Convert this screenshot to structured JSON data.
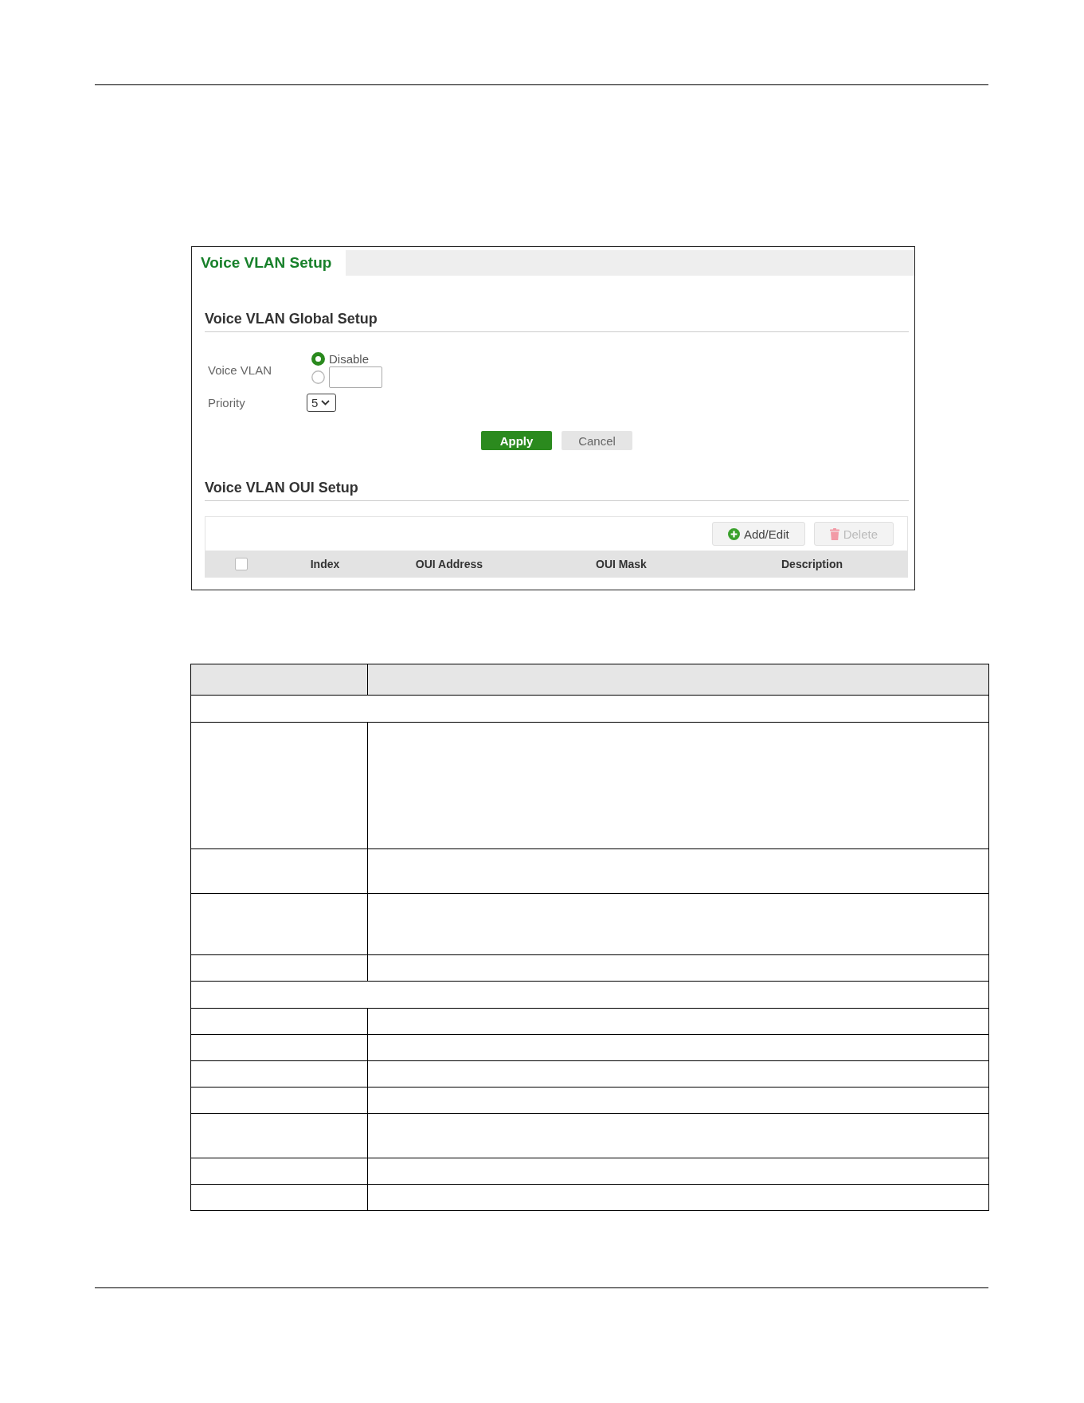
{
  "tabs": [
    {
      "label": "Voice VLAN Setup",
      "selected": true
    }
  ],
  "global_setup": {
    "title": "Voice VLAN Global Setup",
    "fields": [
      {
        "kind": "radio_group",
        "label": "Voice VLAN",
        "options": [
          {
            "kind": "labeled",
            "label": "Disable",
            "selected": true
          },
          {
            "kind": "input",
            "selected": false
          }
        ]
      },
      {
        "kind": "select",
        "label": "Priority",
        "value": "5"
      }
    ],
    "buttons": [
      {
        "kind": "primary",
        "label": "Apply"
      },
      {
        "kind": "secondary",
        "label": "Cancel"
      }
    ]
  },
  "oui_setup": {
    "title": "Voice VLAN OUI Setup",
    "buttons": [
      {
        "kind": "add",
        "label": "Add/Edit",
        "disabled": false
      },
      {
        "kind": "delete",
        "label": "Delete",
        "disabled": true
      }
    ],
    "table": {
      "header_checkbox": {
        "checked": false
      },
      "columns": [
        "Index",
        "OUI Address",
        "OUI Mask",
        "Description"
      ]
    }
  },
  "description_table": {
    "rows": [
      {
        "kind": "header"
      },
      {
        "kind": "section"
      },
      {
        "kind": "tall"
      },
      {
        "kind": "double"
      },
      {
        "kind": "triple"
      },
      {
        "kind": "single"
      },
      {
        "kind": "section"
      },
      {
        "kind": "single"
      },
      {
        "kind": "single"
      },
      {
        "kind": "single"
      },
      {
        "kind": "single"
      },
      {
        "kind": "double"
      },
      {
        "kind": "single"
      },
      {
        "kind": "single"
      }
    ]
  }
}
